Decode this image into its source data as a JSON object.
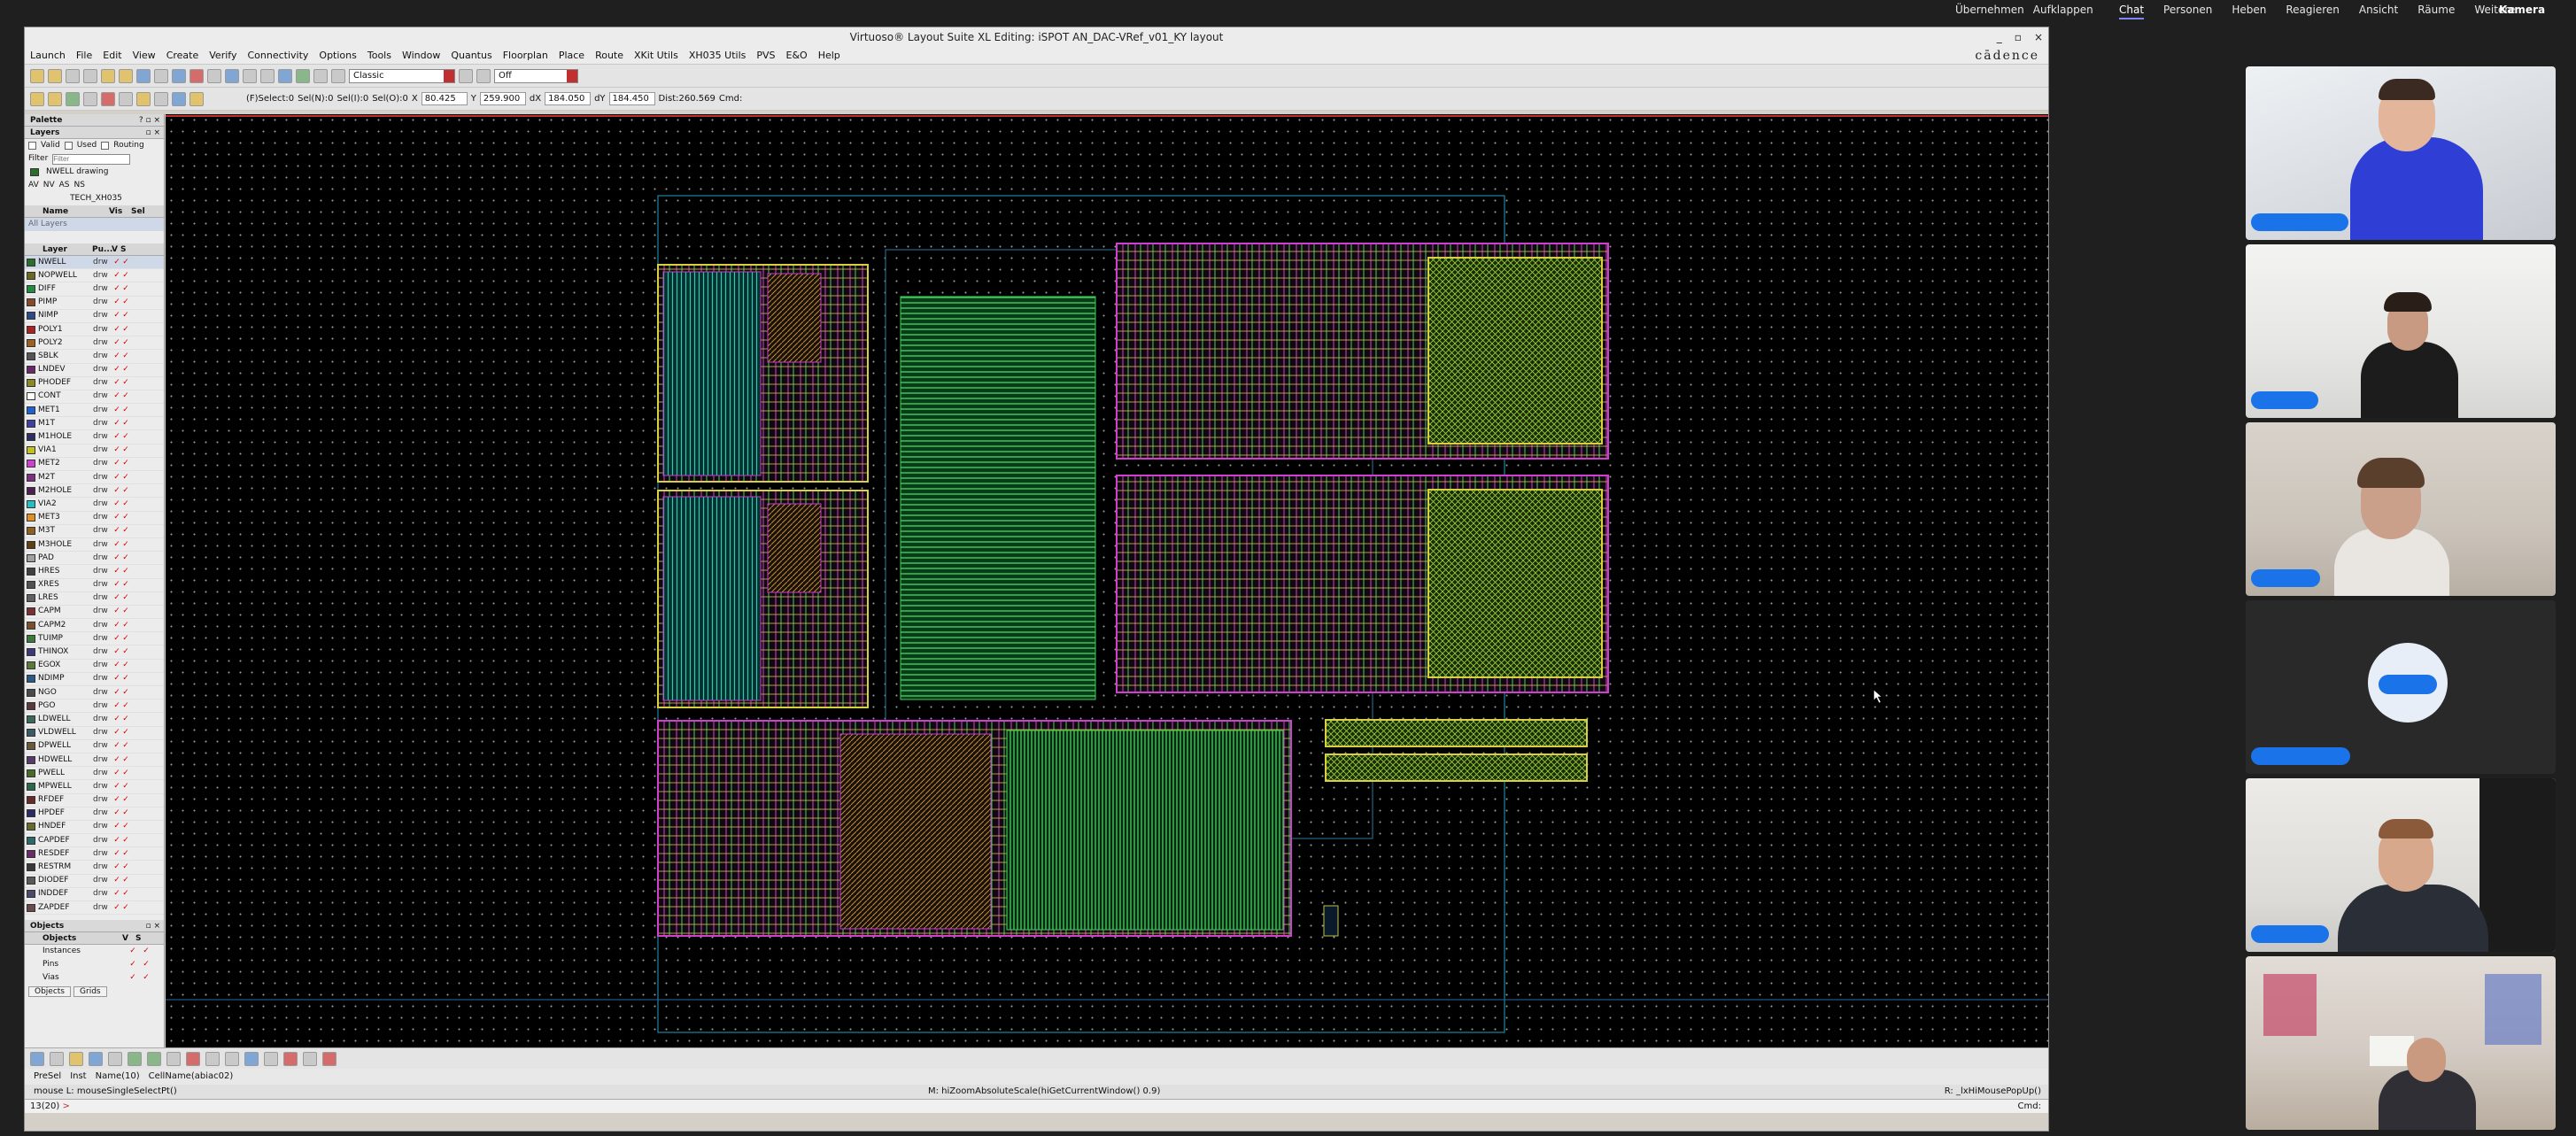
{
  "teams": {
    "left_items": [
      "Übernehmen",
      "Aufklappen"
    ],
    "tabs": [
      "Chat",
      "Personen",
      "Heben",
      "Reagieren",
      "Ansicht",
      "Räume",
      "Weitere"
    ],
    "camera_label": "Kamera"
  },
  "window": {
    "title": "Virtuoso® Layout Suite XL Editing: iSPOT AN_DAC-VRef_v01_KY layout",
    "controls": [
      "_",
      "▫",
      "×"
    ],
    "brand": "cādence"
  },
  "menu": [
    "Launch",
    "File",
    "Edit",
    "View",
    "Create",
    "Verify",
    "Connectivity",
    "Options",
    "Tools",
    "Window",
    "Quantus",
    "Floorplan",
    "Place",
    "Route",
    "XKit Utils",
    "XH035 Utils",
    "PVS",
    "E&O",
    "Help"
  ],
  "toolbar": {
    "mode_select": "Classic",
    "snap_select": "Off"
  },
  "status_row": {
    "select": "(F)Select:0",
    "sel_n": "Sel(N):0",
    "sel_i": "Sel(I):0",
    "sel_o": "Sel(O):0",
    "x_label": "X",
    "x_value": "80.425",
    "y_label": "Y",
    "y_value": "259.900",
    "dx_label": "dX",
    "dx_value": "184.050",
    "dy_label": "dY",
    "dy_value": "184.450",
    "dist": "Dist:260.569",
    "cmd": "Cmd:"
  },
  "palette": {
    "title": "Palette",
    "layers_title": "Layers",
    "filters": [
      "Valid",
      "Used",
      "Routing"
    ],
    "filter_label": "Filter",
    "filter_placeholder": "Filter",
    "current_layer": "NWELL drawing",
    "visibility": [
      "AV",
      "NV",
      "AS",
      "NS"
    ],
    "tech": "TECH_XH035",
    "lpp_headers": [
      "Name",
      "Vis",
      "Sel"
    ],
    "lpp_first": "All Layers",
    "layer_headers": [
      "Layer",
      "Pu...",
      "V",
      "S"
    ],
    "layers": [
      {
        "name": "NWELL",
        "purpose": "drw",
        "color": "#2a6f2a"
      },
      {
        "name": "NOPWELL",
        "purpose": "drw",
        "color": "#6a6a20"
      },
      {
        "name": "DIFF",
        "purpose": "drw",
        "color": "#1f8f3f"
      },
      {
        "name": "PIMP",
        "purpose": "drw",
        "color": "#8a4a2a"
      },
      {
        "name": "NIMP",
        "purpose": "drw",
        "color": "#2a4a8a"
      },
      {
        "name": "POLY1",
        "purpose": "drw",
        "color": "#b02020"
      },
      {
        "name": "POLY2",
        "purpose": "drw",
        "color": "#a06020"
      },
      {
        "name": "SBLK",
        "purpose": "drw",
        "color": "#555555"
      },
      {
        "name": "LNDEV",
        "purpose": "drw",
        "color": "#6a2a6a"
      },
      {
        "name": "PHODEF",
        "purpose": "drw",
        "color": "#8a8a20"
      },
      {
        "name": "CONT",
        "purpose": "drw",
        "color": "#ffffff"
      },
      {
        "name": "MET1",
        "purpose": "drw",
        "color": "#2060d0"
      },
      {
        "name": "M1T",
        "purpose": "drw",
        "color": "#4040a0"
      },
      {
        "name": "M1HOLE",
        "purpose": "drw",
        "color": "#303060"
      },
      {
        "name": "VIA1",
        "purpose": "drw",
        "color": "#c0c020"
      },
      {
        "name": "MET2",
        "purpose": "drw",
        "color": "#d040d0"
      },
      {
        "name": "M2T",
        "purpose": "drw",
        "color": "#803080"
      },
      {
        "name": "M2HOLE",
        "purpose": "drw",
        "color": "#502050"
      },
      {
        "name": "VIA2",
        "purpose": "drw",
        "color": "#20c0c0"
      },
      {
        "name": "MET3",
        "purpose": "drw",
        "color": "#e09020"
      },
      {
        "name": "M3T",
        "purpose": "drw",
        "color": "#906020"
      },
      {
        "name": "M3HOLE",
        "purpose": "drw",
        "color": "#604010"
      },
      {
        "name": "PAD",
        "purpose": "drw",
        "color": "#a0a0a0"
      },
      {
        "name": "HRES",
        "purpose": "drw",
        "color": "#404040"
      },
      {
        "name": "XRES",
        "purpose": "drw",
        "color": "#505050"
      },
      {
        "name": "LRES",
        "purpose": "drw",
        "color": "#606060"
      },
      {
        "name": "CAPM",
        "purpose": "drw",
        "color": "#7a3030"
      },
      {
        "name": "CAPM2",
        "purpose": "drw",
        "color": "#7a5030"
      },
      {
        "name": "TUIMP",
        "purpose": "drw",
        "color": "#3a7a3a"
      },
      {
        "name": "THINOX",
        "purpose": "drw",
        "color": "#3a3a7a"
      },
      {
        "name": "EGOX",
        "purpose": "drw",
        "color": "#5a7a3a"
      },
      {
        "name": "NDIMP",
        "purpose": "drw",
        "color": "#2a5a8a"
      },
      {
        "name": "NGO",
        "purpose": "drw",
        "color": "#4a4a4a"
      },
      {
        "name": "PGO",
        "purpose": "drw",
        "color": "#5a3a3a"
      },
      {
        "name": "LDWELL",
        "purpose": "drw",
        "color": "#3a6a5a"
      },
      {
        "name": "VLDWELL",
        "purpose": "drw",
        "color": "#3a5a6a"
      },
      {
        "name": "DPWELL",
        "purpose": "drw",
        "color": "#6a5a3a"
      },
      {
        "name": "HDWELL",
        "purpose": "drw",
        "color": "#5a3a6a"
      },
      {
        "name": "PWELL",
        "purpose": "drw",
        "color": "#4a6a2a"
      },
      {
        "name": "MPWELL",
        "purpose": "drw",
        "color": "#2a6a4a"
      },
      {
        "name": "RFDEF",
        "purpose": "drw",
        "color": "#6a2a2a"
      },
      {
        "name": "HPDEF",
        "purpose": "drw",
        "color": "#2a2a6a"
      },
      {
        "name": "HNDEF",
        "purpose": "drw",
        "color": "#6a6a2a"
      },
      {
        "name": "CAPDEF",
        "purpose": "drw",
        "color": "#2a6a6a"
      },
      {
        "name": "RESDEF",
        "purpose": "drw",
        "color": "#6a2a6a"
      },
      {
        "name": "RESTRM",
        "purpose": "drw",
        "color": "#3a3a3a"
      },
      {
        "name": "DIODEF",
        "purpose": "drw",
        "color": "#5a5a5a"
      },
      {
        "name": "INDDEF",
        "purpose": "drw",
        "color": "#4a4a6a"
      },
      {
        "name": "ZAPDEF",
        "purpose": "drw",
        "color": "#6a4a4a"
      }
    ],
    "objects_title": "Objects",
    "object_headers": [
      "Objects",
      "V",
      "S"
    ],
    "objects": [
      "Instances",
      "Pins",
      "Vias"
    ],
    "bottom_tabs": [
      "Objects",
      "Grids"
    ]
  },
  "bottom_status": {
    "items": [
      "PreSel",
      "Inst",
      "Name(10)",
      "CellName(abiac02)"
    ],
    "mouse_left": "mouse L: mouseSingleSelectPt()",
    "mouse_middle": "M: hiZoomAbsoluteScale(hiGetCurrentWindow() 0.9)",
    "mouse_right": "R: _lxHiMousePopUp()",
    "cmd_counter": "13(20)",
    "cmd_prompt": ">",
    "cmd_label": "Cmd:"
  },
  "colors": {
    "teams_accent": "#1a73e8",
    "layout_bg": "#000000"
  }
}
